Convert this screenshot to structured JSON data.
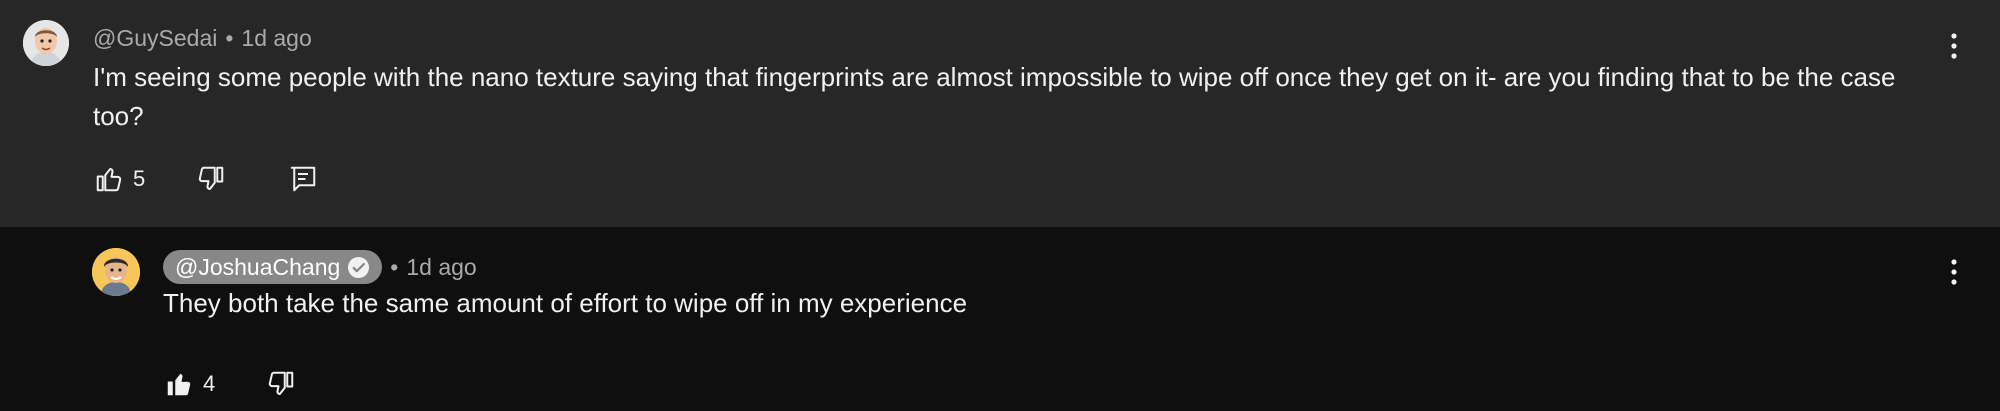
{
  "comment": {
    "handle": "@GuySedai",
    "separator": "•",
    "time": "1d ago",
    "text": "I'm seeing some people with the nano texture saying that fingerprints are almost impossible to wipe off once they get on it- are you finding that to be the case too?",
    "likes": "5",
    "avatar_icon": "memoji-avatar",
    "like_icon": "thumbs-up-outline-icon",
    "dislike_icon": "thumbs-down-outline-icon",
    "reply_icon": "reply-icon",
    "more_icon": "more-vertical-icon"
  },
  "reply": {
    "handle": "@JoshuaChang",
    "verified_icon": "verified-check-icon",
    "separator": "•",
    "time": "1d ago",
    "text": "They both take the same amount of effort to wipe off in my experience",
    "likes": "4",
    "avatar_icon": "memoji-avatar",
    "like_icon": "thumbs-up-filled-icon",
    "dislike_icon": "thumbs-down-outline-icon",
    "more_icon": "more-vertical-icon",
    "colors": {
      "pill": "#888888",
      "avatar_bg": "#f6c65a"
    }
  }
}
